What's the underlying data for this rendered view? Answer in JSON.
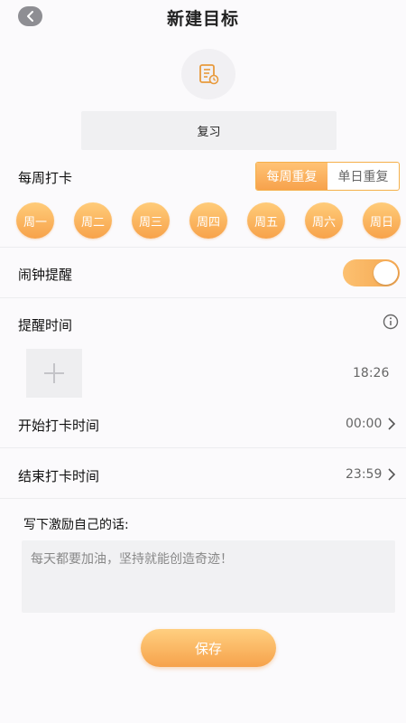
{
  "header": {
    "title": "新建目标",
    "back_icon": "chevron-left-icon"
  },
  "goal": {
    "icon": "notebook-clock-icon",
    "name": "复习"
  },
  "weekly": {
    "label": "每周打卡",
    "repeat_options": [
      "每周重复",
      "单日重复"
    ],
    "selected_option": "每周重复",
    "days": [
      "周一",
      "周二",
      "周三",
      "周四",
      "周五",
      "周六",
      "周日"
    ]
  },
  "alarm": {
    "label": "闹钟提醒",
    "enabled": true
  },
  "reminder": {
    "label": "提醒时间",
    "time": "18:26",
    "add_icon": "plus-icon",
    "info_icon": "info-icon"
  },
  "start": {
    "label": "开始打卡时间",
    "value": "00:00"
  },
  "end": {
    "label": "结束打卡时间",
    "value": "23:59"
  },
  "motivation": {
    "label": "写下激励自己的话:",
    "placeholder": "每天都要加油，坚持就能创造奇迹！"
  },
  "save_label": "保存",
  "colors": {
    "accent": "#f7a24c",
    "accent_light": "#ffcc7a",
    "background": "#fbfafc"
  }
}
